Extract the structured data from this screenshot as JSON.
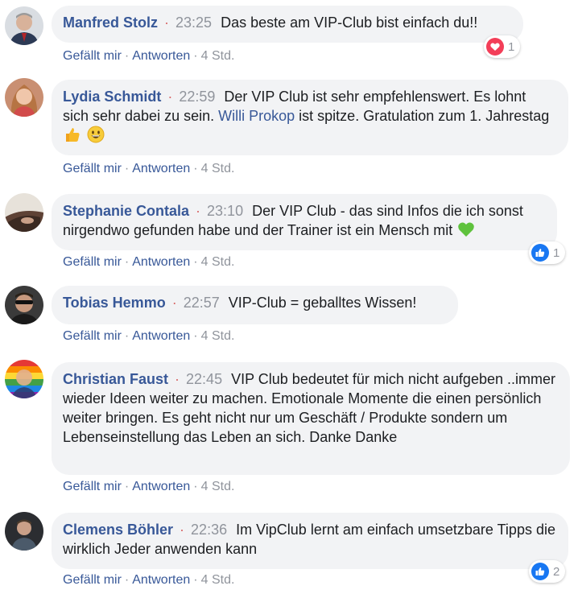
{
  "comments": [
    {
      "author": "Manfred Stolz",
      "time": "23:25",
      "text": "Das beste am VIP-Club bist einfach du!!",
      "like_label": "Gefällt mir",
      "reply_label": "Antworten",
      "age": "4 Std.",
      "reaction": {
        "icon": "heart-icon",
        "count": "1"
      }
    },
    {
      "author": "Lydia Schmidt",
      "time": "22:59",
      "text_before": "Der VIP Club ist sehr empfehlenswert. Es lohnt sich sehr dabei zu sein.",
      "mention": "Willi Prokop",
      "text_after": "ist spitze. Gratulation zum 1. Jahrestag",
      "emojis": [
        "thumbs-up-emoji",
        "grinning-face-emoji"
      ],
      "like_label": "Gefällt mir",
      "reply_label": "Antworten",
      "age": "4 Std."
    },
    {
      "author": "Stephanie Contala",
      "time": "23:10",
      "text": "Der VIP Club - das sind Infos die ich sonst nirgendwo gefunden habe und der Trainer ist ein Mensch mit",
      "emojis": [
        "green-heart-emoji"
      ],
      "like_label": "Gefällt mir",
      "reply_label": "Antworten",
      "age": "4 Std.",
      "reaction": {
        "icon": "like-icon",
        "count": "1"
      }
    },
    {
      "author": "Tobias Hemmo",
      "time": "22:57",
      "text": "VIP-Club = geballtes Wissen!",
      "like_label": "Gefällt mir",
      "reply_label": "Antworten",
      "age": "4 Std."
    },
    {
      "author": "Christian Faust",
      "time": "22:45",
      "text": "VIP Club bedeutet für mich nicht aufgeben ..immer wieder Ideen weiter zu machen. Emotionale Momente die einen persönlich weiter bringen. Es geht nicht nur um Geschäft / Produkte sondern um Lebenseinstellung das Leben an sich. Danke Danke",
      "like_label": "Gefällt mir",
      "reply_label": "Antworten",
      "age": "4 Std."
    },
    {
      "author": "Clemens Böhler",
      "time": "22:36",
      "text": "Im VipClub lernt am einfach umsetzbare Tipps die wirklich Jeder anwenden kann",
      "like_label": "Gefällt mir",
      "reply_label": "Antworten",
      "age": "4 Std.",
      "reaction": {
        "icon": "like-icon",
        "count": "2"
      }
    }
  ],
  "colors": {
    "author": "#385898",
    "bubble": "#f2f3f5",
    "timestamp": "#90949c",
    "separator_dot": "#d96a6a",
    "like_blue": "#1877f2",
    "heart_red": "#f33e58"
  }
}
